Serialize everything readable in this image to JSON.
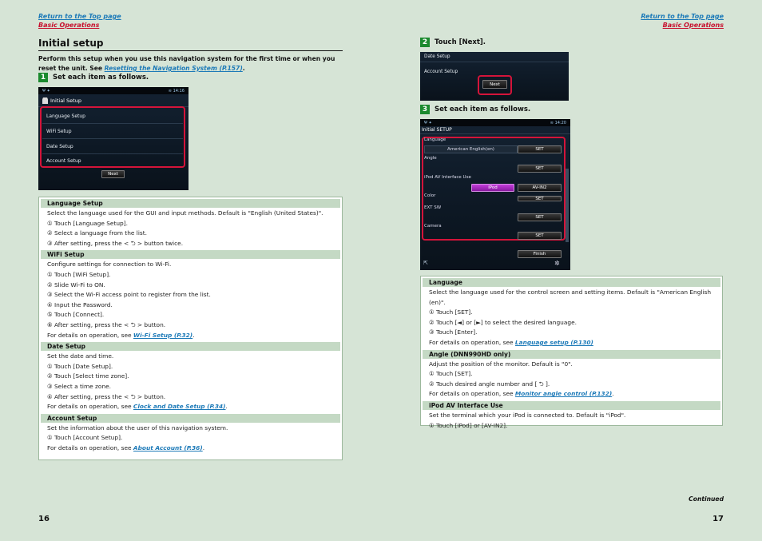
{
  "left": {
    "nav": {
      "top_page": "Return to the Top page",
      "basic_ops": "Basic Operations"
    },
    "title": "Initial setup",
    "intro_text": "Perform this setup when you use this navigation system for the first time or when you reset the unit. See",
    "intro_link": "Resetting the Navigation System (P.157)",
    "intro_end": ".",
    "step1": {
      "num": "1",
      "text": "Set each item as follows."
    },
    "screen": {
      "time": "14:16",
      "header": "Initial Setup",
      "rows": [
        "Language Setup",
        "WiFi Setup",
        "Date Setup",
        "Account Setup"
      ],
      "next_label": "Next"
    },
    "table": {
      "language": {
        "title": "Language Setup",
        "lines": [
          "Select the language used for the GUI and input methods. Default is \"English (United States)\".",
          "① Touch [Language Setup].",
          "② Select a language from the list.",
          "③ After setting, press the < ⮌ > button twice."
        ]
      },
      "wifi": {
        "title": "WiFi Setup",
        "lines": [
          "Configure settings for connection to Wi-Fi.",
          "① Touch [WiFi Setup].",
          "② Slide Wi-Fi to ON.",
          "③ Select the Wi-Fi access point to register from the list.",
          "④ Input the Password.",
          "⑤ Touch [Connect].",
          "⑥ After setting, press the < ⮌ > button."
        ],
        "details_prefix": "For details on operation, see",
        "link": "Wi-Fi Setup (P.32)",
        "end": "."
      },
      "date": {
        "title": "Date Setup",
        "lines": [
          "Set the date and time.",
          "① Touch [Date Setup].",
          "② Touch [Select time zone].",
          "③ Select a time zone.",
          "④ After setting, press the < ⮌ > button."
        ],
        "details_prefix": "For details on operation, see",
        "link": "Clock and Date Setup (P.34)",
        "end": "."
      },
      "account": {
        "title": "Account Setup",
        "lines": [
          "Set the information about the user of this navigation system.",
          "① Touch [Account Setup]."
        ],
        "details_prefix": "For details on operation, see",
        "link": "About Account (P.36)",
        "end": "."
      }
    },
    "page_number": "16"
  },
  "right": {
    "nav": {
      "top_page": "Return to the Top page",
      "basic_ops": "Basic Operations"
    },
    "step2": {
      "num": "2",
      "text": "Touch [Next]."
    },
    "screen2": {
      "row1": "Date Setup",
      "row2": "Account Setup",
      "next_label": "Next"
    },
    "step3": {
      "num": "3",
      "text": "Set each item as follows."
    },
    "screen3": {
      "time": "14:20",
      "header": "Initial SETUP",
      "language_label": "Language",
      "language_value": "American English(en)",
      "set": "SET",
      "angle_label": "Angle",
      "ipod_label": "iPod AV Interface Use",
      "ipod_btn": "iPod",
      "avin2_btn": "AV-IN2",
      "color_label": "Color",
      "ext_label": "EXT SW",
      "camera_label": "Camera",
      "finish_label": "Finish"
    },
    "table": {
      "language": {
        "title": "Language",
        "lines": [
          "Select the language used for the control screen and setting items. Default is \"American English (en)\".",
          "① Touch [SET].",
          "② Touch [◄] or [►] to select the desired language.",
          "③ Touch [Enter]."
        ],
        "details_prefix": "For details on operation, see",
        "link": "Language setup (P.130)",
        "end": ""
      },
      "angle": {
        "title": "Angle (DNN990HD only)",
        "lines": [
          "Adjust the position of the monitor. Default is \"0\".",
          "① Touch [SET].",
          "② Touch desired angle number and [ ⮌ ]."
        ],
        "details_prefix": "For details on operation, see",
        "link": "Monitor angle control (P.132)",
        "end": "."
      },
      "ipod": {
        "title": "iPod AV Interface Use",
        "lines": [
          "Set the terminal which your iPod is connected to. Default is \"iPod\".",
          "① Touch [iPod] or [AV-IN2]."
        ]
      }
    },
    "continued": "Continued",
    "page_number": "17"
  }
}
